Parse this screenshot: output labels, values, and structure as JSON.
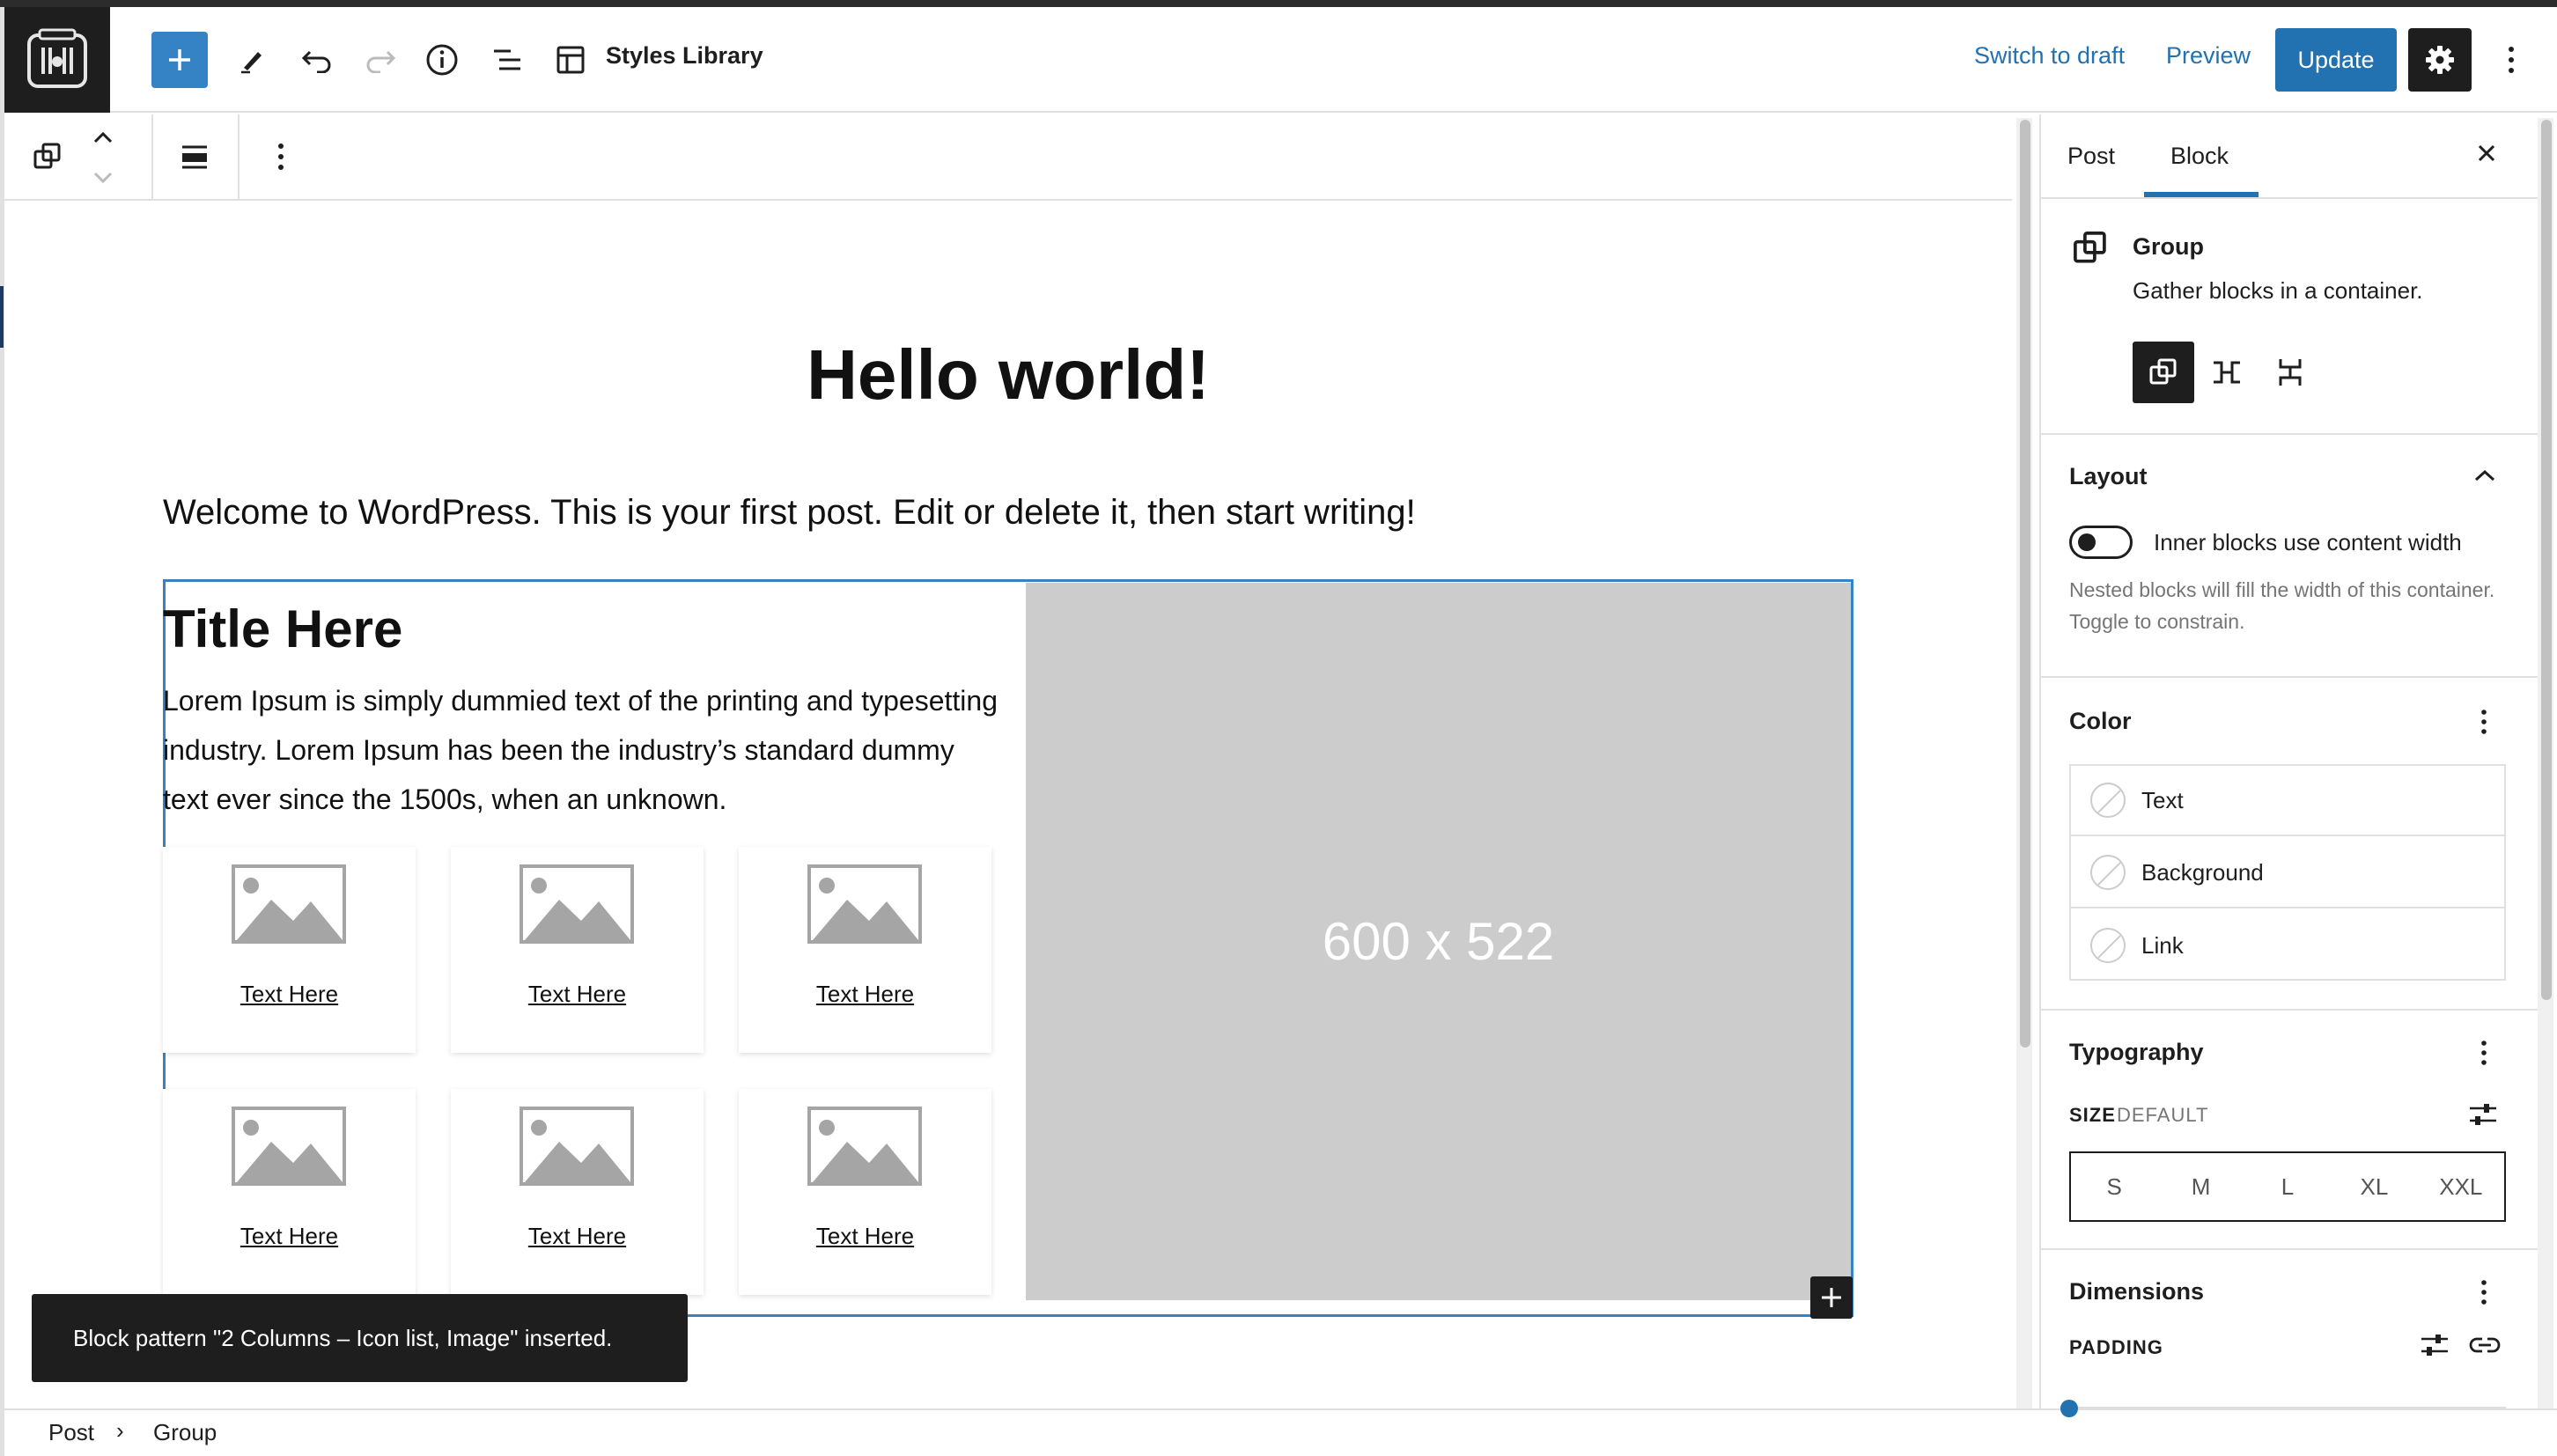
{
  "header": {
    "document_title": "Styles Library",
    "switch_to_draft": "Switch to draft",
    "preview": "Preview",
    "update": "Update"
  },
  "post": {
    "title": "Hello world!",
    "paragraph": "Welcome to WordPress. This is your first post. Edit or delete it, then start writing!"
  },
  "pattern": {
    "title": "Title Here",
    "text": "Lorem Ipsum is simply dummied text of the printing and typesetting industry. Lorem Ipsum has been the industry’s standard dummy text ever since the 1500s, when an unknown.",
    "image_placeholder": "600 x 522",
    "cards": [
      "Text Here",
      "Text Here",
      "Text Here",
      "Text Here",
      "Text Here",
      "Text Here"
    ]
  },
  "snackbar": {
    "message": "Block pattern \"2 Columns – Icon list, Image\" inserted."
  },
  "breadcrumb": {
    "items": [
      "Post",
      "Group"
    ],
    "separator": "›"
  },
  "sidebar": {
    "tabs": [
      "Post",
      "Block"
    ],
    "active_tab": "Block",
    "block": {
      "name": "Group",
      "description": "Gather blocks in a container."
    },
    "layout": {
      "title": "Layout",
      "toggle_label": "Inner blocks use content width",
      "toggle_on": false,
      "help": "Nested blocks will fill the width of this container. Toggle to constrain."
    },
    "color": {
      "title": "Color",
      "items": [
        "Text",
        "Background",
        "Link"
      ]
    },
    "typography": {
      "title": "Typography",
      "size_label": "SIZE",
      "size_value": "DEFAULT",
      "sizes": [
        "S",
        "M",
        "L",
        "XL",
        "XXL"
      ]
    },
    "dimensions": {
      "title": "Dimensions",
      "padding_label": "PADDING"
    }
  },
  "colors": {
    "accent": "#2271b1",
    "dark": "#1e1e1e",
    "placeholder": "#cccccc"
  }
}
